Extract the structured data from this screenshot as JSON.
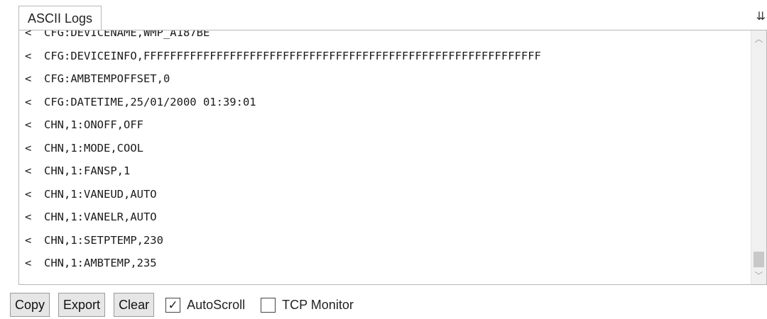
{
  "panel": {
    "tab_label": "ASCII Logs",
    "pin_glyph": "⇊"
  },
  "logs": [
    {
      "dir": "<",
      "text": "CFG:DEVICENAME,WMP_A187BE"
    },
    {
      "dir": "<",
      "text": "CFG:DEVICEINFO,FFFFFFFFFFFFFFFFFFFFFFFFFFFFFFFFFFFFFFFFFFFFFFFFFFFFFFFFFFFF"
    },
    {
      "dir": "<",
      "text": "CFG:AMBTEMPOFFSET,0"
    },
    {
      "dir": "<",
      "text": "CFG:DATETIME,25/01/2000 01:39:01"
    },
    {
      "dir": "<",
      "text": "CHN,1:ONOFF,OFF"
    },
    {
      "dir": "<",
      "text": "CHN,1:MODE,COOL"
    },
    {
      "dir": "<",
      "text": "CHN,1:FANSP,1"
    },
    {
      "dir": "<",
      "text": "CHN,1:VANEUD,AUTO"
    },
    {
      "dir": "<",
      "text": "CHN,1:VANELR,AUTO"
    },
    {
      "dir": "<",
      "text": "CHN,1:SETPTEMP,230"
    },
    {
      "dir": "<",
      "text": "CHN,1:AMBTEMP,235"
    }
  ],
  "scrollbar": {
    "up_glyph": "︿",
    "down_glyph": "﹀"
  },
  "toolbar": {
    "copy_label": "Copy",
    "export_label": "Export",
    "clear_label": "Clear",
    "autoscroll_label": "AutoScroll",
    "autoscroll_checked": true,
    "autoscroll_mark": "✓",
    "tcp_monitor_label": "TCP Monitor",
    "tcp_monitor_checked": false
  }
}
